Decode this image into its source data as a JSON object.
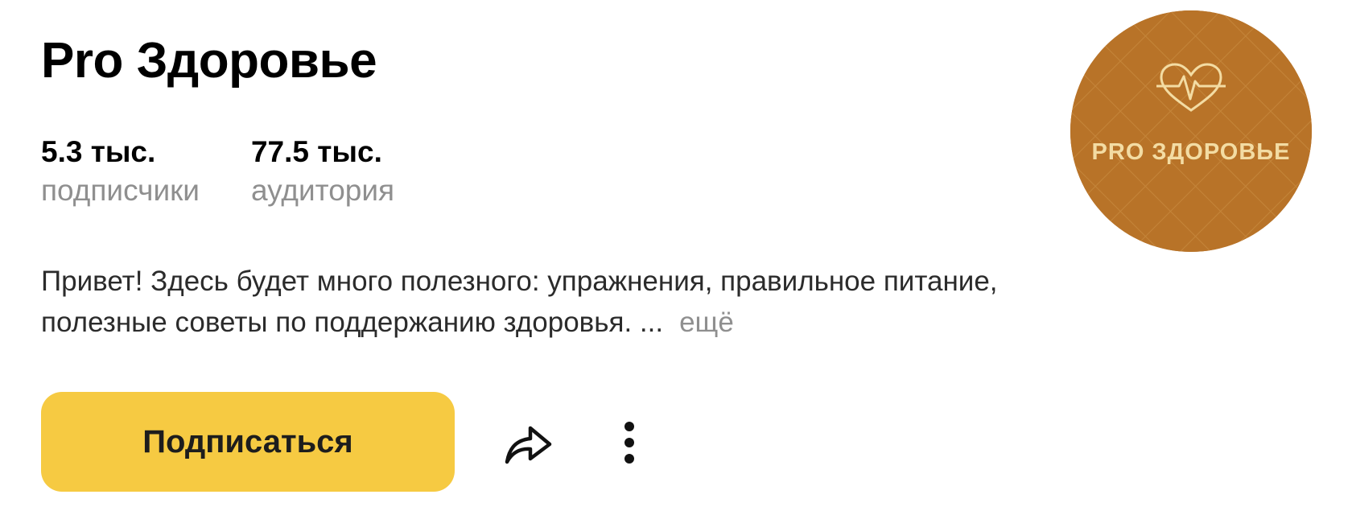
{
  "channel": {
    "title": "Pro Здоровье",
    "avatar_text": "PRO ЗДОРОВЬЕ",
    "avatar_color": "#b87328"
  },
  "stats": {
    "subscribers_value": "5.3 тыс.",
    "subscribers_label": "подписчики",
    "audience_value": "77.5 тыс.",
    "audience_label": "аудитория"
  },
  "description": {
    "text": "Привет! Здесь будет много полезного: упражнения, правильное питание, полезные советы по поддержанию здоровья. ...",
    "more_label": "ещё"
  },
  "actions": {
    "subscribe_label": "Подписаться",
    "subscribe_color": "#f6ca42",
    "share_icon": "share-arrow-icon",
    "more_icon": "vertical-dots-icon"
  }
}
